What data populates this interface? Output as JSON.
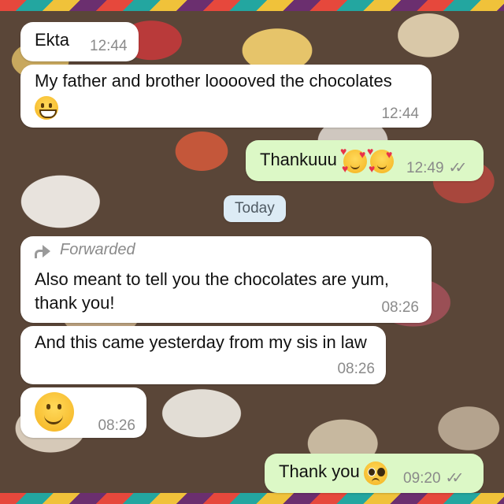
{
  "messages": {
    "m1": {
      "text": "Ekta",
      "time": "12:44"
    },
    "m2": {
      "text": "My father and brother looooved the chocolates",
      "emoji": "grinning-face",
      "time": "12:44"
    },
    "m3": {
      "text": "Thankuuu",
      "emoji": "smiling-face-with-hearts",
      "time": "12:49",
      "status": "read-double-check"
    },
    "date_divider": "Today",
    "m4": {
      "forwarded_label": "Forwarded",
      "text_line1": "Also meant to tell you the chocolates are yum,",
      "text_line2": "thank you!",
      "time": "08:26"
    },
    "m5": {
      "text": "And this came yesterday from my sis in law",
      "time": "08:26"
    },
    "m6": {
      "emoji": "slightly-smiling-face",
      "time": "08:26"
    },
    "m7": {
      "text": "Thank you",
      "emoji": "pleading-face",
      "time": "09:20",
      "status": "read-double-check"
    }
  },
  "ticks_glyph": "✓✓",
  "colors": {
    "incoming": "#ffffff",
    "outgoing": "#dcf8c6",
    "date_pill": "#dcebf5",
    "timestamp": "#8a8a8a"
  }
}
